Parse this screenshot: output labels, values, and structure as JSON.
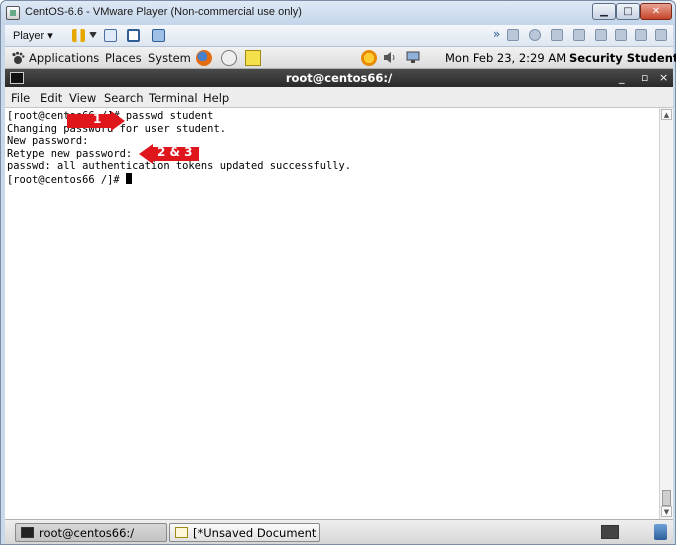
{
  "vmware": {
    "title": "CentOS-6.6 - VMware Player (Non-commercial use only)",
    "player_menu": "Player",
    "min_glyph": "▁",
    "max_glyph": "□",
    "close_glyph": "✕",
    "overflow_glyph": "»",
    "dropdown_glyph": "▾"
  },
  "panel": {
    "menus": [
      "Applications",
      "Places",
      "System"
    ],
    "clock": "Mon Feb 23,  2:29 AM",
    "user": "Security Student"
  },
  "terminal": {
    "title": "root@centos66:/",
    "min_glyph": "_",
    "max_glyph": "▫",
    "close_glyph": "×",
    "menus": [
      "File",
      "Edit",
      "View",
      "Search",
      "Terminal",
      "Help"
    ],
    "lines": [
      "[root@centos66 /]# passwd student",
      "Changing password for user student.",
      "New password:",
      "Retype new password:",
      "passwd: all authentication tokens updated successfully.",
      "[root@centos66 /]# "
    ],
    "scroll_up_glyph": "▲",
    "scroll_down_glyph": "▼"
  },
  "annotations": {
    "arrow1": "1",
    "arrow2": "2 & 3",
    "color": "#e0161d"
  },
  "taskbar": {
    "items": [
      "root@centos66:/",
      "[*Unsaved Document ..."
    ]
  }
}
